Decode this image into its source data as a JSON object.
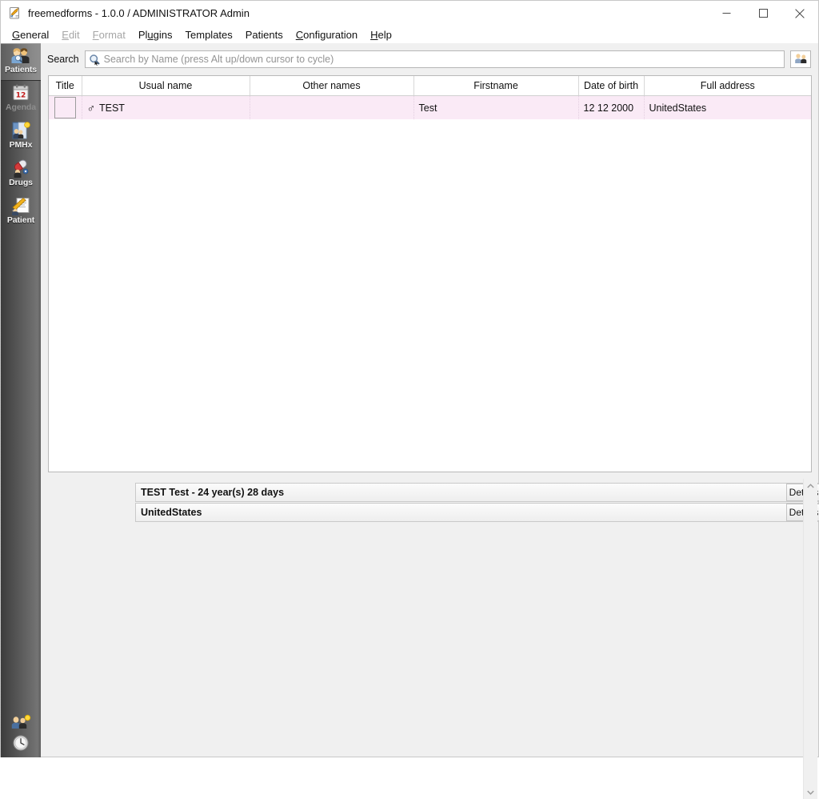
{
  "window": {
    "title": "freemedforms - 1.0.0 /  ADMINISTRATOR Admin",
    "app_icon": "freemedforms-icon",
    "controls": {
      "minimize": "minimize-icon",
      "maximize": "maximize-icon",
      "close": "close-icon"
    }
  },
  "menubar": {
    "items": [
      {
        "label": "General",
        "mnemonic": "G",
        "enabled": true
      },
      {
        "label": "Edit",
        "mnemonic": "E",
        "enabled": false
      },
      {
        "label": "Format",
        "mnemonic": "F",
        "enabled": false
      },
      {
        "label": "Plugins",
        "mnemonic": "u",
        "enabled": true
      },
      {
        "label": "Templates",
        "mnemonic": "",
        "enabled": true
      },
      {
        "label": "Patients",
        "mnemonic": "",
        "enabled": true
      },
      {
        "label": "Configuration",
        "mnemonic": "C",
        "enabled": true
      },
      {
        "label": "Help",
        "mnemonic": "H",
        "enabled": true
      }
    ]
  },
  "dock": {
    "items": [
      {
        "label": "Patients",
        "icon": "patients-icon",
        "active": true,
        "enabled": true
      },
      {
        "label": "Agenda",
        "icon": "calendar-icon",
        "active": false,
        "enabled": false
      },
      {
        "label": "PMHx",
        "icon": "pmhx-icon",
        "active": false,
        "enabled": true
      },
      {
        "label": "Drugs",
        "icon": "drugs-icon",
        "active": false,
        "enabled": true
      },
      {
        "label": "Patient",
        "icon": "patient-form-icon",
        "active": false,
        "enabled": true
      }
    ],
    "bottom": [
      {
        "icon": "users-status-icon"
      },
      {
        "icon": "clock-icon"
      }
    ]
  },
  "search": {
    "label": "Search",
    "placeholder": "Search by Name (press Alt up/down cursor to cycle)",
    "value": "",
    "icon": "search-icon",
    "button_icon": "patient-filter-icon"
  },
  "table": {
    "columns": [
      "Title",
      "Usual name",
      "Other names",
      "Firstname",
      "Date of birth",
      "Full address"
    ],
    "rows": [
      {
        "title": "",
        "gender_symbol": "♂",
        "usual_name": "TEST",
        "other_names": "",
        "firstname": "Test",
        "date_of_birth": "12 12 2000",
        "full_address": "UnitedStates",
        "selected": true
      }
    ]
  },
  "details": {
    "panels": [
      {
        "text": "TEST Test - 24 year(s) 28 days",
        "button": "Details"
      },
      {
        "text": "UnitedStates",
        "button": "Details"
      }
    ]
  },
  "scrollbar": {
    "up_icon": "chevron-up-icon",
    "down_icon": "chevron-down-icon"
  },
  "colors": {
    "selected_row": "#faeaf6",
    "dock_dark": "#3c3c3c",
    "dock_light": "#747474",
    "panel_bg": "#f0f0f0",
    "border": "#b9b9b9"
  }
}
